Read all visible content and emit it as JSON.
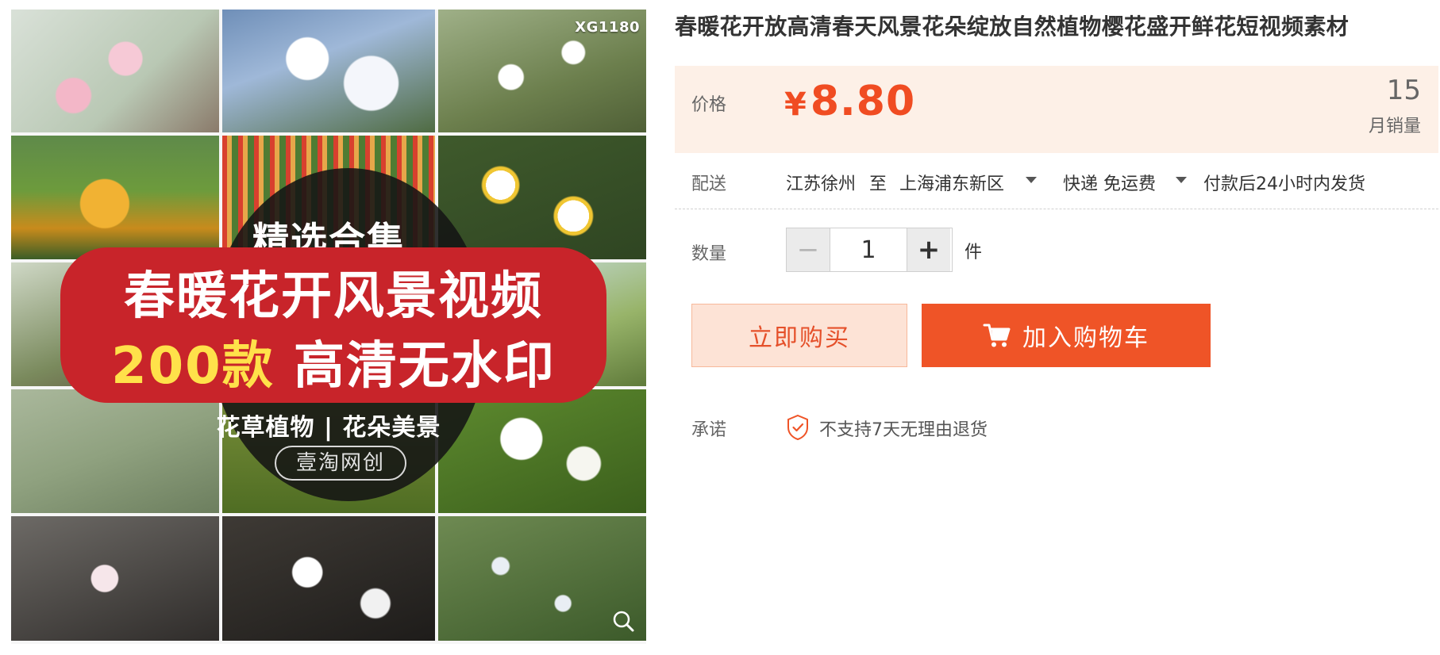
{
  "product_image": {
    "code": "XG1180",
    "circle_top": "精选合集",
    "banner_line1": "春暖花开风景视频",
    "banner_line2_highlight": "200款",
    "banner_line2_rest": "高清无水印",
    "circle_sub": "花草植物 | 花朵美景",
    "brand": "壹淘网创"
  },
  "product": {
    "title": "春暖花开放高清春天风景花朵绽放自然植物樱花盛开鲜花短视频素材"
  },
  "price": {
    "label": "价格",
    "currency": "¥",
    "amount": "8.80",
    "sales_count": "15",
    "sales_label": "月销量"
  },
  "delivery": {
    "label": "配送",
    "from": "江苏徐州",
    "to_word": "至",
    "destination": "上海浦东新区",
    "method": "快递 免运费",
    "promise": "付款后24小时内发货"
  },
  "quantity": {
    "label": "数量",
    "value": "1",
    "minus": "−",
    "plus": "+",
    "unit": "件"
  },
  "actions": {
    "buy_now": "立即购买",
    "add_to_cart": "加入购物车"
  },
  "guarantee": {
    "label": "承诺",
    "text": "不支持7天无理由退货"
  },
  "colors": {
    "accent": "#ef5427",
    "price": "#f04c22",
    "price_panel_bg": "#fdf0e7",
    "buy_bg": "#fde3d6",
    "banner_red": "#c8242a",
    "banner_yellow": "#ffe14a"
  },
  "icons": [
    "zoom-icon",
    "cart-icon",
    "shield-check-icon",
    "caret-down-icon"
  ]
}
